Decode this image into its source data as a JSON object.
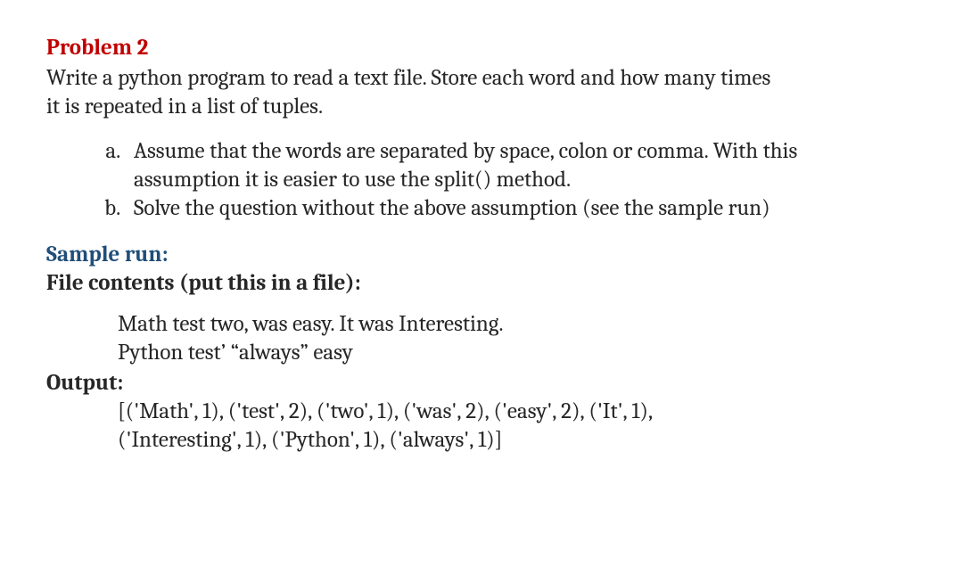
{
  "title": "Problem 2",
  "description_line1": "Write a python program to read a text file. Store each word and how many times",
  "description_line2": "it is repeated in a list of tuples.",
  "subitems": {
    "a_line1": "Assume that the words are separated by space, colon or comma. With this",
    "a_line2": "assumption it is easier to use the split() method.",
    "b": "Solve the question without the above assumption (see the sample run)"
  },
  "sample_run_label": "Sample run:",
  "file_contents_label": "File contents (put this in a file):",
  "file_contents": {
    "line1": "Math test two, was easy. It was Interesting.",
    "line2": "Python test’ “always” easy"
  },
  "output_label": "Output:",
  "output": {
    "line1": "[('Math', 1), ('test', 2), ('two', 1), ('was', 2), ('easy', 2), ('It', 1),",
    "line2": "('Interesting', 1), ('Python', 1), ('always', 1)]"
  }
}
